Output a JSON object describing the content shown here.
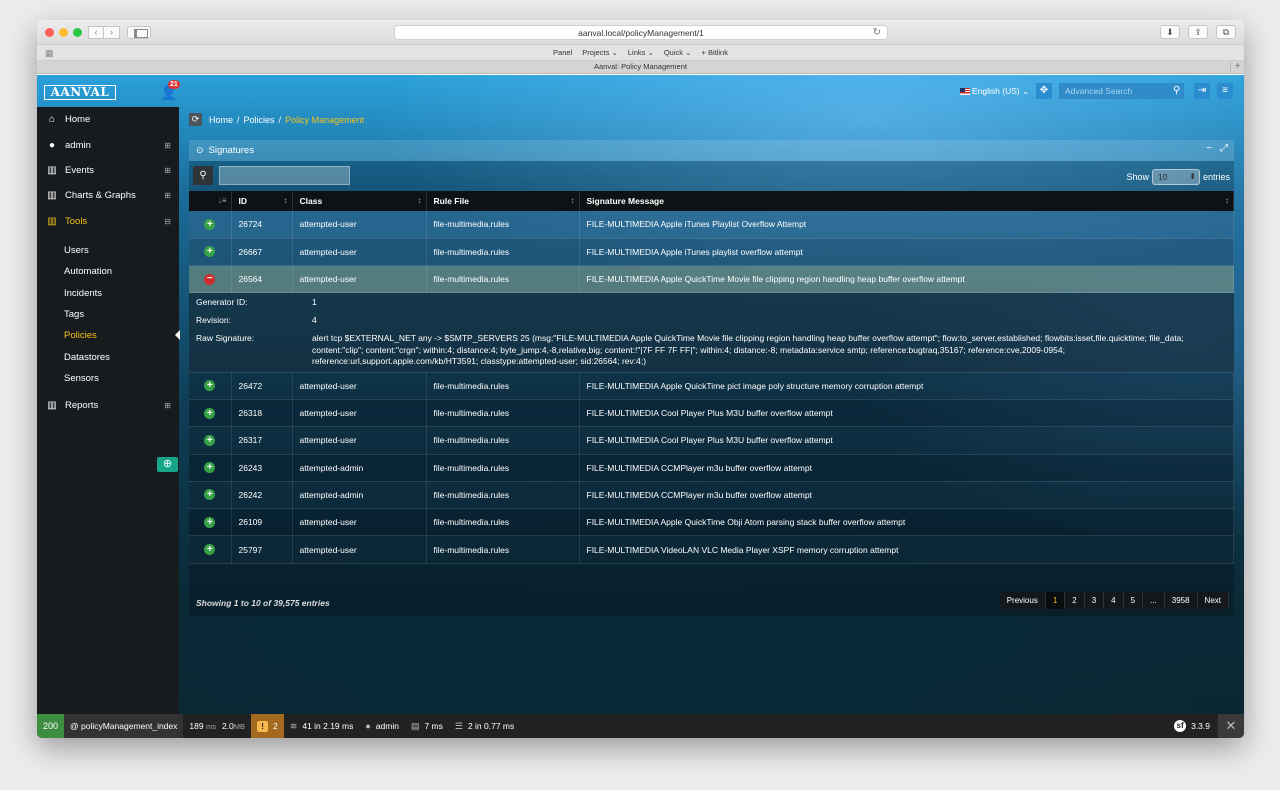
{
  "browser": {
    "url": "aanval.local/policyManagement/1",
    "bookmarks": [
      "Panel",
      "Projects ⌄",
      "Links ⌄",
      "Quick ⌄",
      "+ Bitlink"
    ],
    "tab_title": "Aanval: Policy Management"
  },
  "header": {
    "logo": "AANVAL",
    "notifications": "21",
    "language": "English (US) ⌄",
    "search_placeholder": "Advanced Search"
  },
  "sidebar": {
    "items": [
      {
        "label": "Home",
        "icon": "home-icon",
        "glyph": "⌂",
        "expand": ""
      },
      {
        "label": "admin",
        "icon": "user-icon",
        "glyph": "👤",
        "expand": "⊞"
      },
      {
        "label": "Events",
        "icon": "chart-icon",
        "glyph": "▥",
        "expand": "⊞"
      },
      {
        "label": "Charts & Graphs",
        "icon": "chart-icon",
        "glyph": "▥",
        "expand": "⊞"
      },
      {
        "label": "Tools",
        "icon": "chart-icon",
        "glyph": "▥",
        "expand": "⊟",
        "active": true
      }
    ],
    "subitems": [
      "Users",
      "Automation",
      "Incidents",
      "Tags",
      "Policies",
      "Datastores",
      "Sensors"
    ],
    "active_sub": "Policies",
    "reports": {
      "label": "Reports",
      "expand": "⊞"
    }
  },
  "breadcrumb": {
    "home": "Home",
    "policies": "Policies",
    "current": "Policy Management"
  },
  "panel": {
    "title": "Signatures",
    "show_label": "Show",
    "show_value": "10",
    "entries_label": "entries"
  },
  "table": {
    "columns": [
      "",
      "ID",
      "Class",
      "Rule File",
      "Signature Message"
    ],
    "rows": [
      {
        "id": "26724",
        "class": "attempted-user",
        "file": "file-multimedia.rules",
        "msg": "FILE-MULTIMEDIA Apple iTunes Playlist Overflow Attempt"
      },
      {
        "id": "26667",
        "class": "attempted-user",
        "file": "file-multimedia.rules",
        "msg": "FILE-MULTIMEDIA Apple iTunes playlist overflow attempt"
      },
      {
        "id": "26564",
        "class": "attempted-user",
        "file": "file-multimedia.rules",
        "msg": "FILE-MULTIMEDIA Apple QuickTime Movie file clipping region handling heap buffer overflow attempt"
      },
      {
        "id": "26472",
        "class": "attempted-user",
        "file": "file-multimedia.rules",
        "msg": "FILE-MULTIMEDIA Apple QuickTime pict image poly structure memory corruption attempt"
      },
      {
        "id": "26318",
        "class": "attempted-user",
        "file": "file-multimedia.rules",
        "msg": "FILE-MULTIMEDIA Cool Player Plus M3U buffer overflow attempt"
      },
      {
        "id": "26317",
        "class": "attempted-user",
        "file": "file-multimedia.rules",
        "msg": "FILE-MULTIMEDIA Cool Player Plus M3U buffer overflow attempt"
      },
      {
        "id": "26243",
        "class": "attempted-admin",
        "file": "file-multimedia.rules",
        "msg": "FILE-MULTIMEDIA CCMPlayer m3u buffer overflow attempt"
      },
      {
        "id": "26242",
        "class": "attempted-admin",
        "file": "file-multimedia.rules",
        "msg": "FILE-MULTIMEDIA CCMPlayer m3u buffer overflow attempt"
      },
      {
        "id": "26109",
        "class": "attempted-user",
        "file": "file-multimedia.rules",
        "msg": "FILE-MULTIMEDIA Apple QuickTime Obji Atom parsing stack buffer overflow attempt"
      },
      {
        "id": "25797",
        "class": "attempted-user",
        "file": "file-multimedia.rules",
        "msg": "FILE-MULTIMEDIA VideoLAN VLC Media Player XSPF memory corruption attempt"
      }
    ],
    "detail": {
      "generator_label": "Generator ID:",
      "generator_value": "1",
      "revision_label": "Revision:",
      "revision_value": "4",
      "raw_label": "Raw Signature:",
      "raw_value": "alert tcp $EXTERNAL_NET any -> $SMTP_SERVERS 25 (msg:\"FILE-MULTIMEDIA Apple QuickTime Movie file clipping region handling heap buffer overflow attempt\"; flow:to_server,established; flowbits:isset,file.quicktime; file_data; content:\"clip\"; content:\"crgn\"; within:4; distance:4; byte_jump:4,-8,relative,big; content:!\"|7F FF 7F FF|\"; within:4; distance:-8; metadata:service smtp; reference:bugtraq,35167; reference:cve,2009-0954; reference:url,support.apple.com/kb/HT3591; classtype:attempted-user; sid:26564; rev:4;)"
    },
    "showing": "Showing 1 to 10 of 39,575 entries",
    "pager": [
      "Previous",
      "1",
      "2",
      "3",
      "4",
      "5",
      "...",
      "3958",
      "Next"
    ]
  },
  "debugbar": {
    "status": "200",
    "route": "@ policyManagement_index",
    "time": "189",
    "time_unit": "ms",
    "memory": "2.0",
    "memory_unit": "MB",
    "warnings": "2",
    "queries": "41 in 2.19 ms",
    "user": "admin",
    "render": "7 ms",
    "cache": "2 in 0.77 ms",
    "version": "3.3.9"
  }
}
